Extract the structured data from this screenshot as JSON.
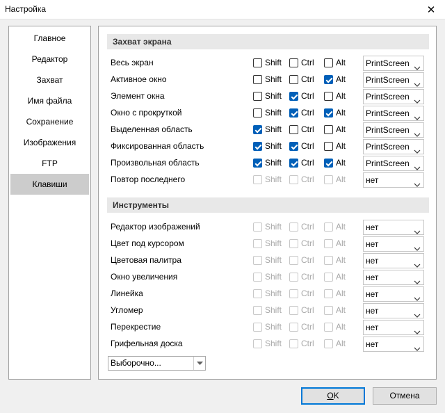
{
  "window": {
    "title": "Настройка",
    "close_glyph": "✕"
  },
  "sidebar": {
    "items": [
      {
        "label": "Главное",
        "selected": false
      },
      {
        "label": "Редактор",
        "selected": false
      },
      {
        "label": "Захват",
        "selected": false
      },
      {
        "label": "Имя файла",
        "selected": false
      },
      {
        "label": "Сохранение",
        "selected": false
      },
      {
        "label": "Изображения",
        "selected": false
      },
      {
        "label": "FTP",
        "selected": false
      },
      {
        "label": "Клавиши",
        "selected": true
      }
    ]
  },
  "modifiers": {
    "shift": "Shift",
    "ctrl": "Ctrl",
    "alt": "Alt"
  },
  "sections": {
    "capture": {
      "title": "Захват экрана",
      "rows": [
        {
          "label": "Весь экран",
          "shift": false,
          "ctrl": false,
          "alt": false,
          "enabled": true,
          "key": "PrintScreen"
        },
        {
          "label": "Активное окно",
          "shift": false,
          "ctrl": false,
          "alt": true,
          "enabled": true,
          "key": "PrintScreen"
        },
        {
          "label": "Элемент окна",
          "shift": false,
          "ctrl": true,
          "alt": false,
          "enabled": true,
          "key": "PrintScreen"
        },
        {
          "label": "Окно с прокруткой",
          "shift": false,
          "ctrl": true,
          "alt": true,
          "enabled": true,
          "key": "PrintScreen"
        },
        {
          "label": "Выделенная область",
          "shift": true,
          "ctrl": false,
          "alt": false,
          "enabled": true,
          "key": "PrintScreen"
        },
        {
          "label": "Фиксированная область",
          "shift": true,
          "ctrl": true,
          "alt": false,
          "enabled": true,
          "key": "PrintScreen"
        },
        {
          "label": "Произвольная область",
          "shift": true,
          "ctrl": true,
          "alt": true,
          "enabled": true,
          "key": "PrintScreen"
        },
        {
          "label": "Повтор последнего",
          "shift": false,
          "ctrl": false,
          "alt": false,
          "enabled": false,
          "key": "нет"
        }
      ]
    },
    "tools": {
      "title": "Инструменты",
      "rows": [
        {
          "label": "Редактор изображений",
          "shift": false,
          "ctrl": false,
          "alt": false,
          "enabled": false,
          "key": "нет"
        },
        {
          "label": "Цвет под курсором",
          "shift": false,
          "ctrl": false,
          "alt": false,
          "enabled": false,
          "key": "нет"
        },
        {
          "label": "Цветовая палитра",
          "shift": false,
          "ctrl": false,
          "alt": false,
          "enabled": false,
          "key": "нет"
        },
        {
          "label": "Окно увеличения",
          "shift": false,
          "ctrl": false,
          "alt": false,
          "enabled": false,
          "key": "нет"
        },
        {
          "label": "Линейка",
          "shift": false,
          "ctrl": false,
          "alt": false,
          "enabled": false,
          "key": "нет"
        },
        {
          "label": "Угломер",
          "shift": false,
          "ctrl": false,
          "alt": false,
          "enabled": false,
          "key": "нет"
        },
        {
          "label": "Перекрестие",
          "shift": false,
          "ctrl": false,
          "alt": false,
          "enabled": false,
          "key": "нет"
        },
        {
          "label": "Грифельная доска",
          "shift": false,
          "ctrl": false,
          "alt": false,
          "enabled": false,
          "key": "нет"
        }
      ]
    }
  },
  "preset": {
    "value": "Выборочно..."
  },
  "buttons": {
    "ok": {
      "mnemonic": "O",
      "rest": "K"
    },
    "cancel": {
      "label": "Отмена"
    }
  },
  "colors": {
    "accent": "#005fb8",
    "selected_bg": "#cccccc",
    "section_bg": "#e8e8e8"
  }
}
